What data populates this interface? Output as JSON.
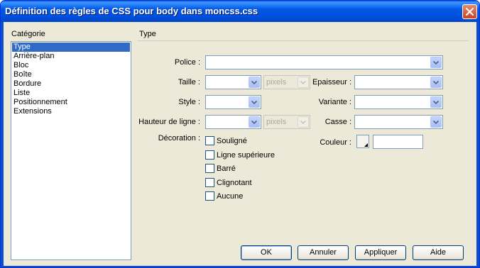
{
  "window": {
    "title": "Définition des règles de CSS pour body dans moncss.css"
  },
  "category": {
    "label": "Catégorie",
    "items": [
      "Type",
      "Arrière-plan",
      "Bloc",
      "Boîte",
      "Bordure",
      "Liste",
      "Positionnement",
      "Extensions"
    ],
    "selected": "Type"
  },
  "panel": {
    "title": "Type",
    "police_label": "Police :",
    "taille_label": "Taille :",
    "taille_unit": "pixels",
    "epaisseur_label": "Epaisseur :",
    "style_label": "Style :",
    "variante_label": "Variante :",
    "hauteur_label": "Hauteur de ligne :",
    "hauteur_unit": "pixels",
    "casse_label": "Casse :",
    "decoration_label": "Décoration :",
    "couleur_label": "Couleur :",
    "decorations": [
      "Souligné",
      "Ligne supérieure",
      "Barré",
      "Clignotant",
      "Aucune"
    ]
  },
  "buttons": {
    "ok": "OK",
    "annuler": "Annuler",
    "appliquer": "Appliquer",
    "aide": "Aide"
  },
  "colors": {
    "titlebar": "#0058e6",
    "selection": "#316ac5",
    "dialog_bg": "#ece9d8"
  }
}
